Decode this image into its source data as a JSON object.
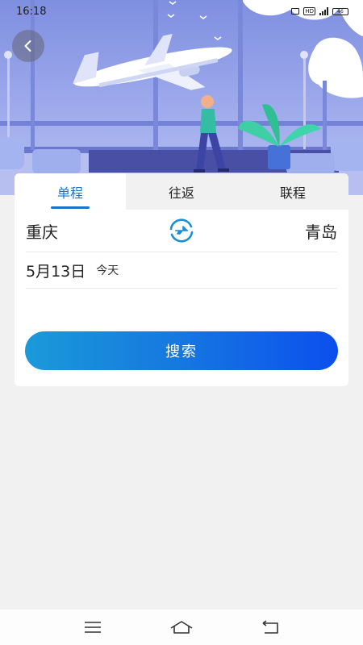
{
  "status_bar": {
    "time": "16:18",
    "hd_label": "HD",
    "battery_text": "46",
    "icons": [
      "vibrate-icon",
      "hd-icon",
      "signal-icon",
      "battery-icon"
    ]
  },
  "header": {
    "back_icon": "chevron-left-icon",
    "banner_illustration": "airport-airplane-illustration"
  },
  "tabs": [
    {
      "label": "单程",
      "active": true
    },
    {
      "label": "往返",
      "active": false
    },
    {
      "label": "联程",
      "active": false
    }
  ],
  "route": {
    "from_city": "重庆",
    "to_city": "青岛",
    "swap_icon": "plane-swap-icon"
  },
  "date": {
    "main": "5月13日",
    "sub": "今天"
  },
  "search": {
    "label": "搜索"
  },
  "nav": {
    "icons": [
      "menu-icon",
      "home-icon",
      "back-icon"
    ]
  },
  "colors": {
    "accent": "#1d73c8",
    "button_start": "#1a9ad9",
    "button_end": "#0b4fee",
    "background": "#f1f1f1",
    "banner": "#8d9be6"
  }
}
